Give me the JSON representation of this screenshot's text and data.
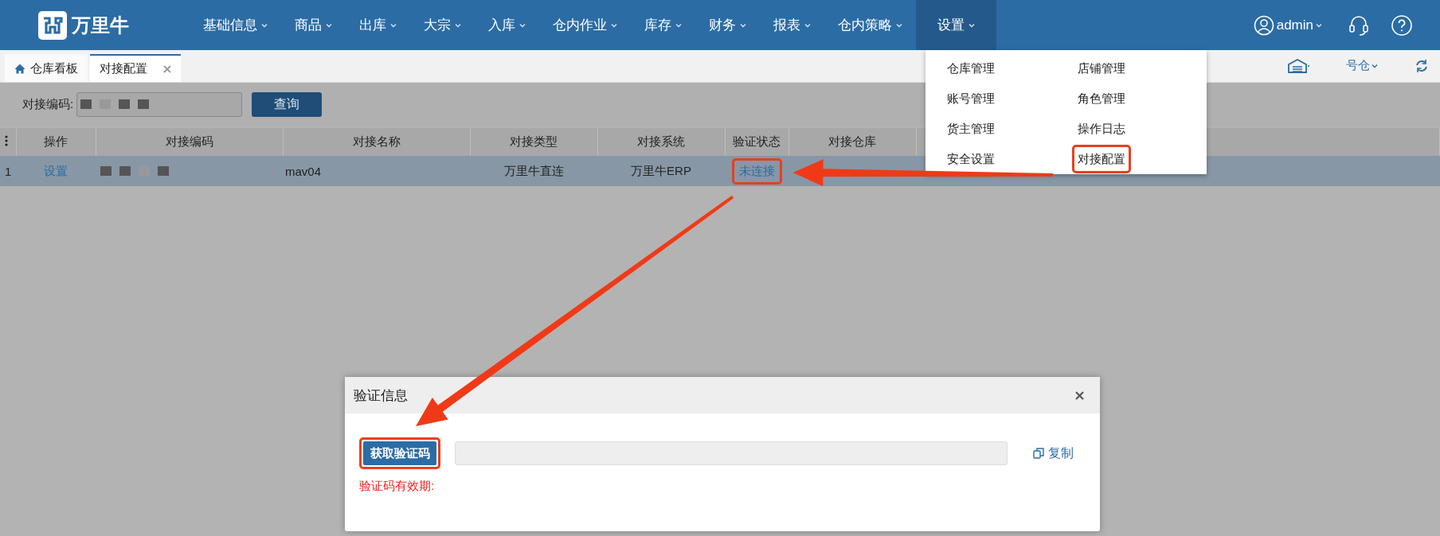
{
  "nav": {
    "logo": "万里牛",
    "menu": [
      {
        "label": "基础信息",
        "selected": false
      },
      {
        "label": "商品",
        "selected": false
      },
      {
        "label": "出库",
        "selected": false
      },
      {
        "label": "大宗",
        "selected": false
      },
      {
        "label": "入库",
        "selected": false
      },
      {
        "label": "仓内作业",
        "selected": false
      },
      {
        "label": "库存",
        "selected": false
      },
      {
        "label": "财务",
        "selected": false
      },
      {
        "label": "报表",
        "selected": false
      },
      {
        "label": "仓内策略",
        "selected": false
      },
      {
        "label": "设置",
        "selected": true
      }
    ],
    "user": "admin"
  },
  "tabs": [
    {
      "label": "仓库看板",
      "kind": "home",
      "selected": false
    },
    {
      "label": "对接配置",
      "kind": "closable",
      "selected": true
    }
  ],
  "toolbar": {
    "warehouse": "号仓"
  },
  "search": {
    "label": "对接编码:",
    "redacted": true,
    "button": "查询"
  },
  "table": {
    "columns": [
      "操作",
      "对接编码",
      "对接名称",
      "对接类型",
      "对接系统",
      "验证状态",
      "对接仓库"
    ],
    "rows": [
      {
        "index": "1",
        "selected": true,
        "action": "设置",
        "code_redacted": true,
        "name": "mav04",
        "type": "万里牛直连",
        "system": "万里牛ERP",
        "status": "未连接",
        "status_highlighted": true
      }
    ]
  },
  "settings_menu": {
    "items": [
      {
        "label": "仓库管理",
        "highlighted": false
      },
      {
        "label": "店铺管理",
        "highlighted": false
      },
      {
        "label": "账号管理",
        "highlighted": false
      },
      {
        "label": "角色管理",
        "highlighted": false
      },
      {
        "label": "货主管理",
        "highlighted": false
      },
      {
        "label": "操作日志",
        "highlighted": false
      },
      {
        "label": "安全设置",
        "highlighted": false
      },
      {
        "label": "对接配置",
        "highlighted": true
      }
    ]
  },
  "dialog": {
    "title": "验证信息",
    "button": "获取验证码",
    "button_highlighted": true,
    "copy": "复制",
    "note": "验证码有效期:"
  },
  "callout_arrows": true
}
